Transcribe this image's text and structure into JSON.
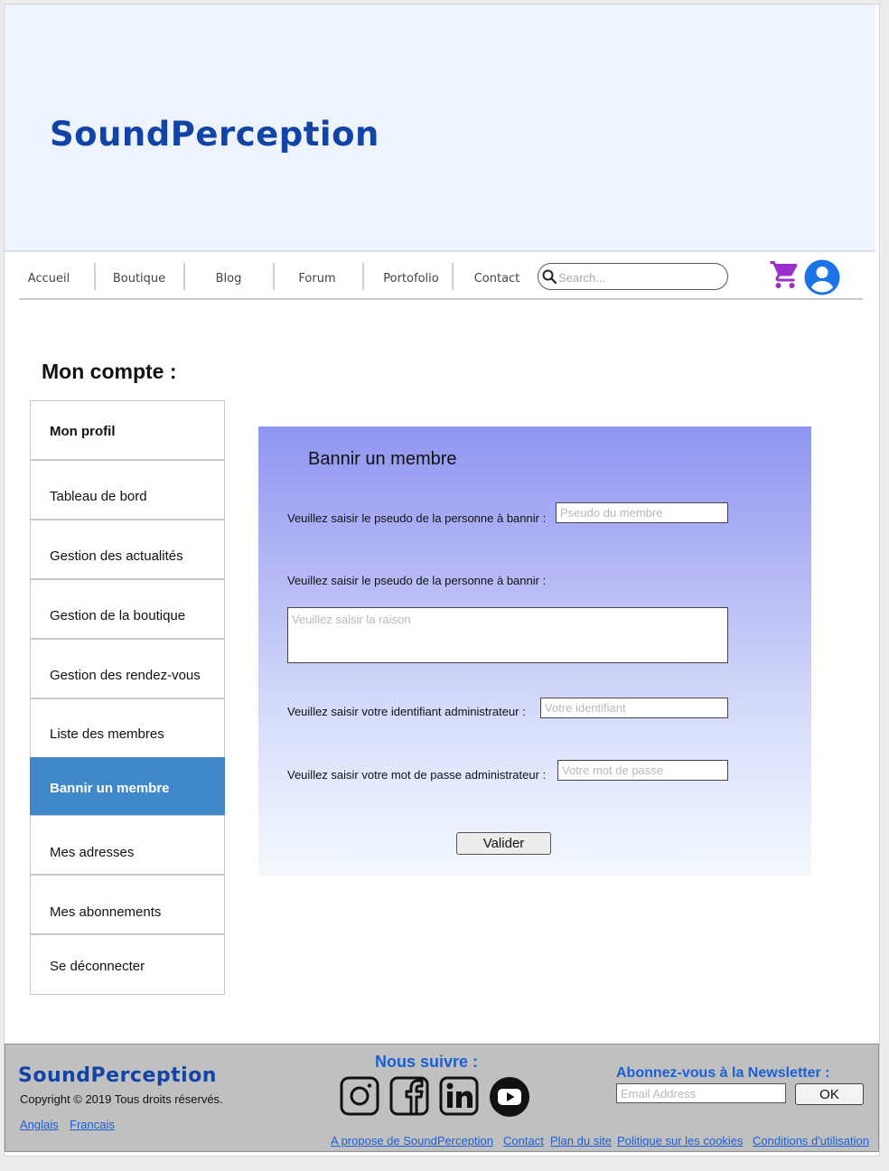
{
  "header": {
    "brand": "SoundPerception"
  },
  "nav": {
    "items": [
      "Accueil",
      "Boutique",
      "Blog",
      "Forum",
      "Portofolio",
      "Contact"
    ],
    "search_placeholder": "Search..."
  },
  "icons": {
    "cart": "cart-icon",
    "user": "user-account-icon",
    "search": "search-icon"
  },
  "colors": {
    "brand": "#1144a6",
    "active_menu": "#3f88c9",
    "cart": "#9b2fc9",
    "user": "#1a73e8",
    "link": "#1a5fd6"
  },
  "account": {
    "title": "Mon compte :",
    "menu": [
      "Mon profil",
      "Tableau de bord",
      "Gestion des actualités",
      "Gestion de la boutique",
      "Gestion des rendez-vous",
      "Liste des membres",
      "Bannir un membre",
      "Mes adresses",
      "Mes abonnements",
      "Se déconnecter"
    ],
    "active_item": "Bannir un membre"
  },
  "form": {
    "title": "Bannir un membre",
    "pseudo_label": "Veuillez saisir le pseudo de la personne à bannir :",
    "pseudo_placeholder": "Pseudo du membre",
    "reason_label": "Veuillez saisir le pseudo de la personne à bannir :",
    "reason_placeholder": "Veuillez saisir la raison",
    "admin_id_label": "Veuillez saisir votre identifiant administrateur :",
    "admin_id_placeholder": "Votre identifiant",
    "admin_pw_label": "Veuillez saisir votre mot de passe administrateur :",
    "admin_pw_placeholder": "Votre mot de passe",
    "submit": "Valider"
  },
  "footer": {
    "brand": "SoundPerception",
    "copyright": "Copyright © 2019 Tous droits réservés.",
    "languages": [
      "Anglais",
      "Francais"
    ],
    "follow_title": "Nous suivre :",
    "social": [
      "instagram-icon",
      "facebook-icon",
      "linkedin-icon",
      "youtube-icon"
    ],
    "newsletter_title": "Abonnez-vous à la Newsletter :",
    "newsletter_placeholder": "Email Address",
    "newsletter_button": "OK",
    "links": [
      "A propose de SoundPerception",
      "Contact",
      "Plan du site",
      "Politique sur les cookies",
      "Conditions d'utilisation"
    ]
  }
}
